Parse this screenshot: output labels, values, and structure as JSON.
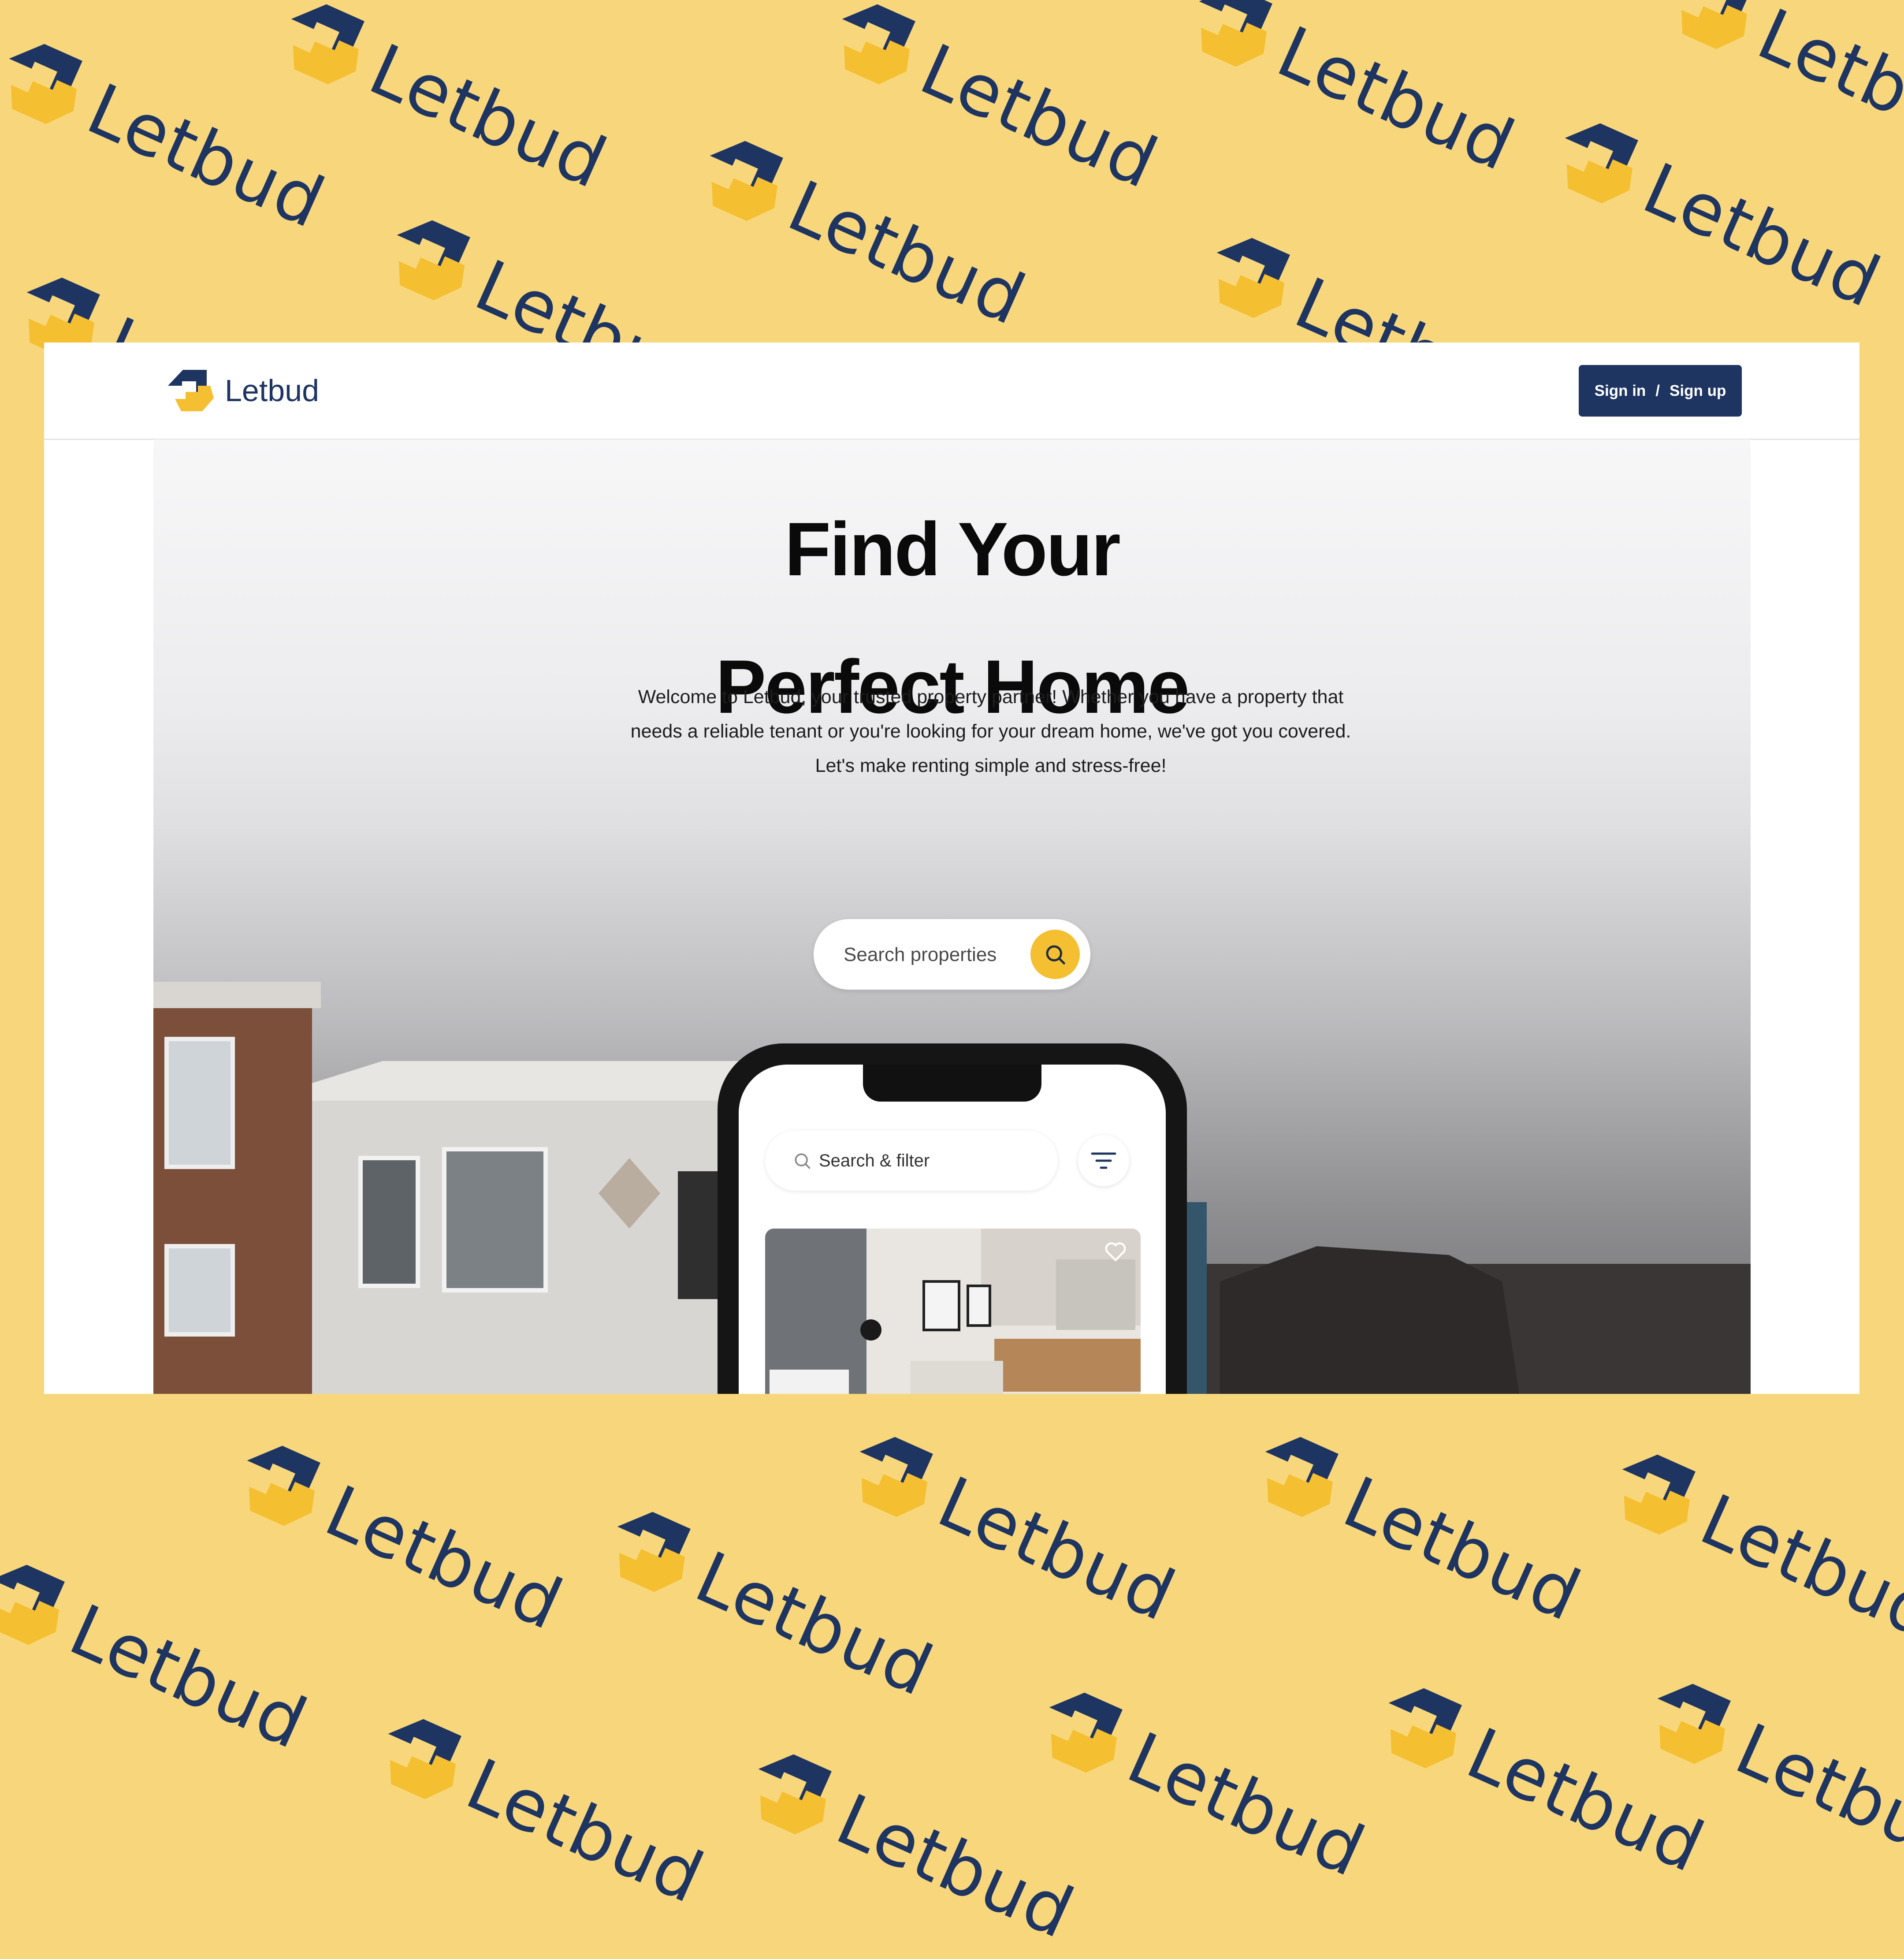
{
  "background": {
    "color": "#f8d77c",
    "pattern_word": "Letbud",
    "pattern_icon": "letbud-logo-icon"
  },
  "brand": {
    "name": "Letbud",
    "primary_color": "#1e3461",
    "accent_color": "#f5bf32"
  },
  "nav": {
    "sign_in": "Sign in",
    "separator": "/",
    "sign_up": "Sign up"
  },
  "hero": {
    "title_line1": "Find Your",
    "title_line2": "Perfect Home",
    "description": "Welcome to Letbud, your trusted property partner! Whether you have a property that needs a reliable tenant or you're looking for your dream home, we've got you covered. Let's make renting simple and stress-free!",
    "search_placeholder": "Search properties",
    "search_icon": "search-icon"
  },
  "phone": {
    "search_label": "Search & filter",
    "filter_icon": "filter-icon",
    "favorite_icon": "heart-icon"
  }
}
